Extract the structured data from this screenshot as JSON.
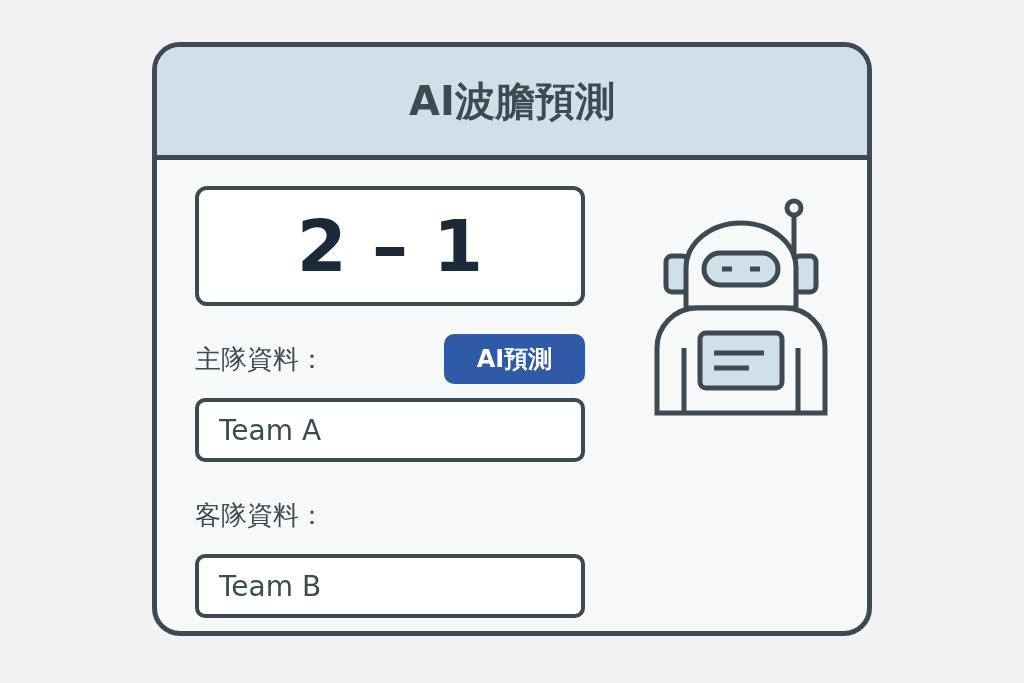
{
  "window": {
    "title": "AI波膽預測"
  },
  "score": "2 – 1",
  "home": {
    "label": "主隊資料：",
    "value": "Team A"
  },
  "predict_button": "AI預測",
  "away": {
    "label": "客隊資料：",
    "value": "Team B"
  }
}
